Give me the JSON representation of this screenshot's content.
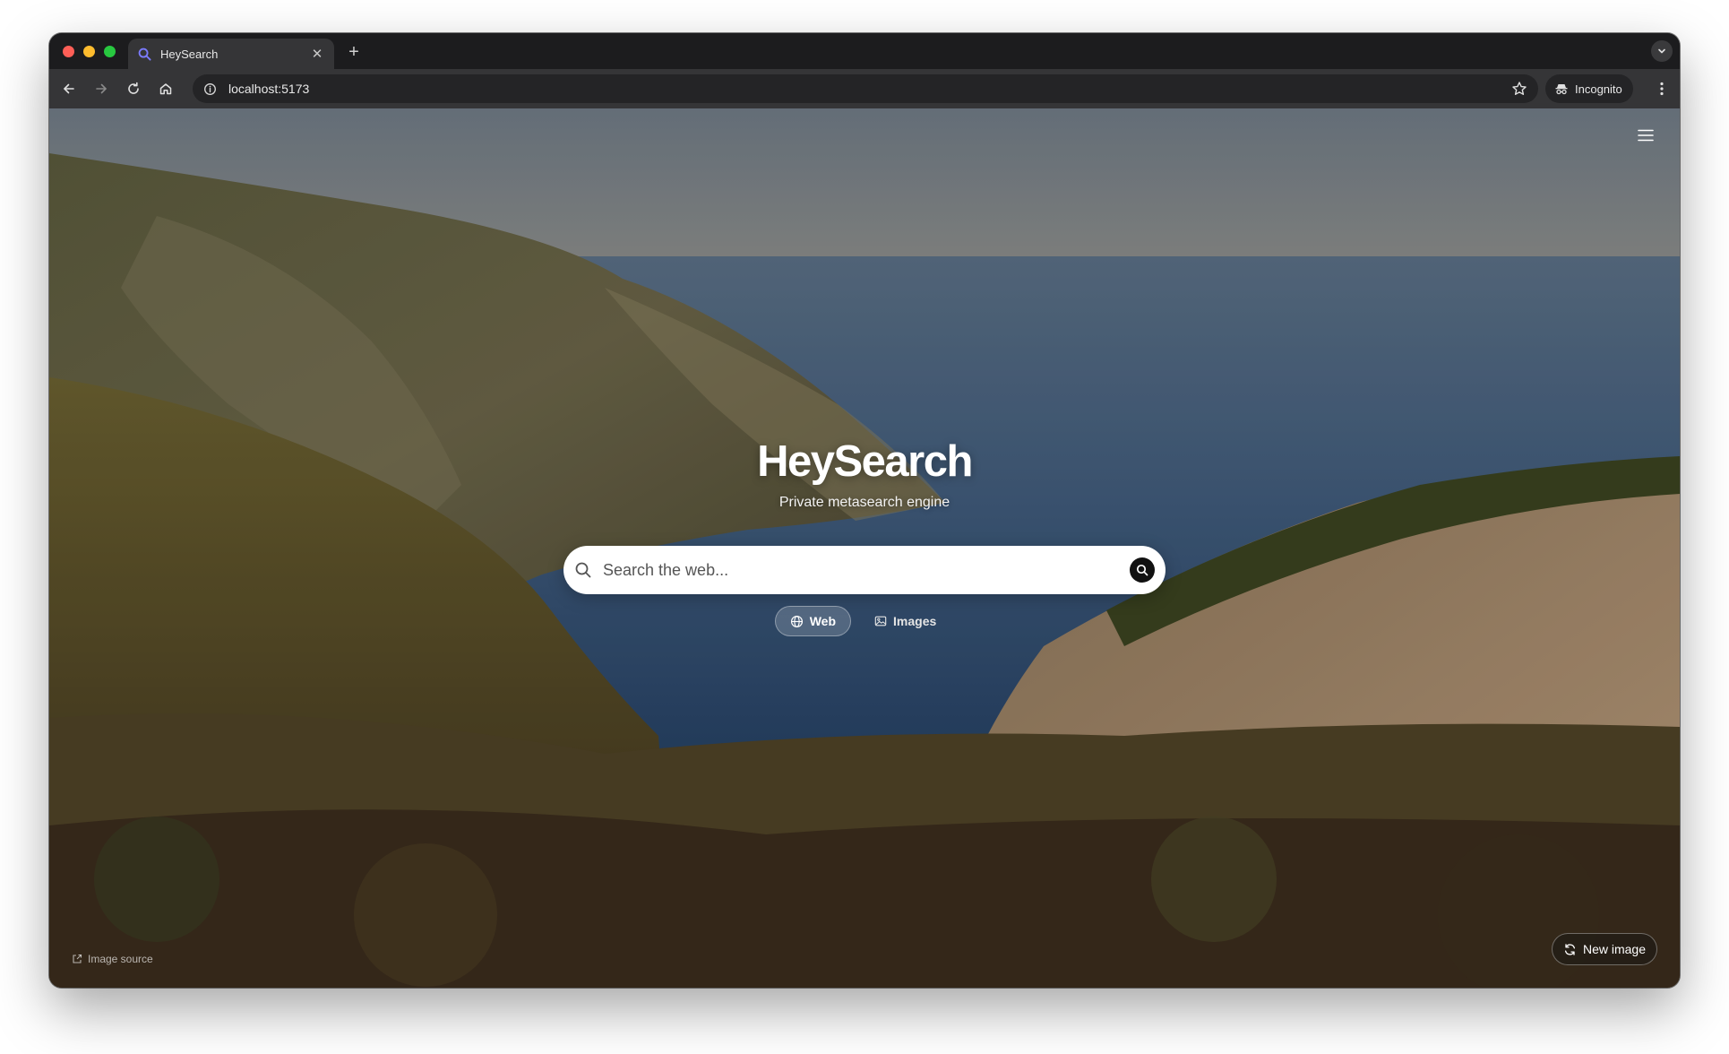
{
  "browser": {
    "tab": {
      "title": "HeySearch",
      "close_glyph": "✕"
    },
    "new_tab_glyph": "+",
    "address_bar": {
      "url": "localhost:5173"
    },
    "profile": {
      "label": "Incognito"
    }
  },
  "page": {
    "brand": "HeySearch",
    "tagline": "Private metasearch engine",
    "search": {
      "placeholder": "Search the web..."
    },
    "modes": [
      {
        "label": "Web",
        "active": true,
        "icon": "globe-icon"
      },
      {
        "label": "Images",
        "active": false,
        "icon": "image-icon"
      }
    ],
    "image_source_label": "Image source",
    "new_image_label": "New image"
  },
  "colors": {
    "traffic_red": "#ff5f57",
    "traffic_yellow": "#febc2e",
    "traffic_green": "#28c840",
    "tab_strip": "#1c1c1e",
    "toolbar": "#353537",
    "search_button": "#111111",
    "favicon_accent": "#7b7bff"
  }
}
